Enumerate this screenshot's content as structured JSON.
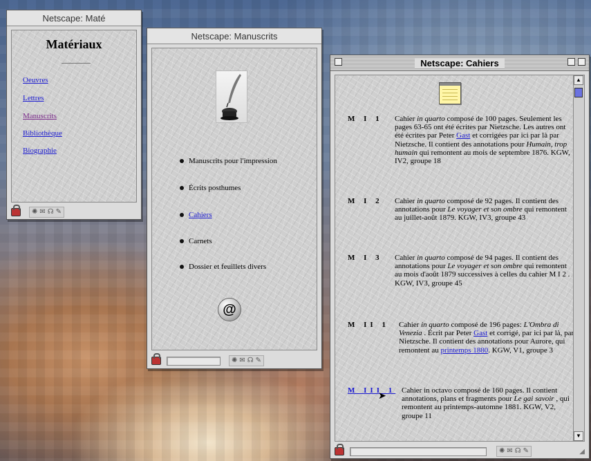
{
  "win_mate": {
    "title": "Netscape: Maté",
    "heading": "Matériaux",
    "links": [
      "Oeuvres",
      "Lettres",
      "Manuscrits",
      "Bibliothèque",
      "Biographie"
    ]
  },
  "win_manuscrits": {
    "title": "Netscape: Manuscrits",
    "items": [
      "Manuscrits pour l'impression",
      "Écrits posthumes",
      "Cahiers",
      "Carnets",
      "Dossier et feuillets divers"
    ],
    "at_symbol": "@"
  },
  "win_cahiers": {
    "title": "Netscape: Cahiers",
    "entries": [
      {
        "code": "M I 1",
        "p1": "Cahier ",
        "i1": "in quarto",
        "p2": "  composé de 100 pages. Seulement les pages 63-65 ont été écrites par Nietzsche. Les autres ont été écrites par Peter ",
        "link": "Gast",
        "p3": " et corrigées par ici par là par Nietzsche. Il contient des annotations pour ",
        "i2": "Humain, trop humain",
        "p4": "  qui remontent au mois de septembre 1876. KGW, IV2, groupe 18"
      },
      {
        "code": "M I 2",
        "p1": "Cahier ",
        "i1": "in quarto",
        "p2": "  composé de 92 pages. Il contient des annotations pour ",
        "i2": "Le voyager et son ombre",
        "p3": "  qui remontent au juillet-août 1879. KGW, IV3, groupe 43"
      },
      {
        "code": "M I 3",
        "p1": "Cahier ",
        "i1": "in quarto",
        "p2": "  composé de 94 pages. Il contient des annotations pour ",
        "i2": "Le voyager et son ombre",
        "p3": "  qui remontent au mois d'août 1879 successives à celles du cahier M I 2 . KGW, IV3, groupe 45"
      },
      {
        "code": "M II 1",
        "p1": "Cahier ",
        "i1": "in quarto",
        "p2": "  composé de 196 pages: ",
        "i2": "L'Ombra di Venezia",
        "p3": "  . Écrit par Peter ",
        "link1": "Gast",
        "p4": " et corrigé, par ici par là, par Nietzsche. Il contient des annotations pour Aurore, qui remontent au ",
        "link2": "printemps 1880",
        "p5": ". KGW, V1, groupe 3"
      },
      {
        "code": "M III 1",
        "p1": "Cahier in octavo composé de 160 pages. Il contient annotations, plans et fragments pour ",
        "i1": "Le gai savoir",
        "p2": "  , qui remontent au printemps-automne 1881. KGW, V2, groupe 11"
      }
    ]
  }
}
